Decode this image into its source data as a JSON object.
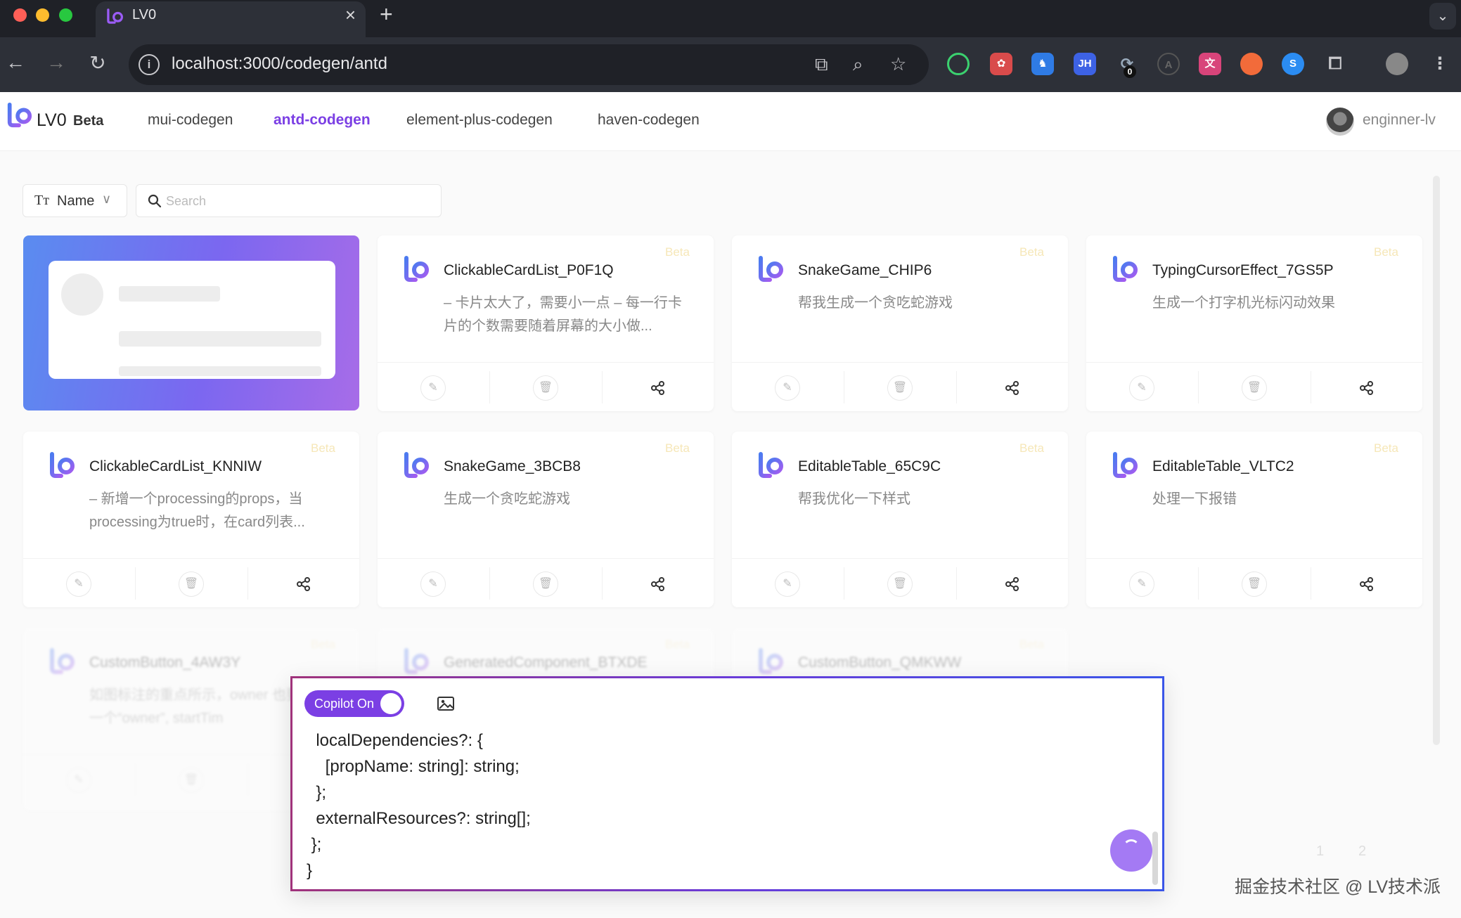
{
  "browser": {
    "tab_title": "LV0",
    "url": "localhost:3000/codegen/antd",
    "extension_badge": "0"
  },
  "header": {
    "brand": "LV0",
    "brand_badge": "Beta",
    "nav": [
      {
        "label": "mui-codegen",
        "active": false
      },
      {
        "label": "antd-codegen",
        "active": true
      },
      {
        "label": "element-plus-codegen",
        "active": false
      },
      {
        "label": "haven-codegen",
        "active": false
      }
    ],
    "user": "enginner-lv"
  },
  "filter": {
    "field_label": "Name",
    "search_placeholder": "Search"
  },
  "cards": [
    {
      "title": "ClickableCardList_P0F1Q",
      "badge": "Beta",
      "desc": "– 卡片太大了，需要小一点 – 每一行卡片的个数需要随着屏幕的大小做..."
    },
    {
      "title": "SnakeGame_CHIP6",
      "badge": "Beta",
      "desc": "帮我生成一个贪吃蛇游戏"
    },
    {
      "title": "TypingCursorEffect_7GS5P",
      "badge": "Beta",
      "desc": "生成一个打字机光标闪动效果"
    },
    {
      "title": "ClickableCardList_KNNIW",
      "badge": "Beta",
      "desc": "– 新增一个processing的props，当processing为true时，在card列表..."
    },
    {
      "title": "SnakeGame_3BCB8",
      "badge": "Beta",
      "desc": "生成一个贪吃蛇游戏"
    },
    {
      "title": "EditableTable_65C9C",
      "badge": "Beta",
      "desc": "帮我优化一下样式"
    },
    {
      "title": "EditableTable_VLTC2",
      "badge": "Beta",
      "desc": "处理一下报错"
    },
    {
      "title": "CustomButton_4AW3Y",
      "badge": "Beta",
      "desc": "如图标注的重点所示，owner 也要包含一个“owner”, startTim"
    },
    {
      "title": "GeneratedComponent_BTXDE",
      "badge": "Beta",
      "desc": ""
    },
    {
      "title": "CustomButton_QMKWW",
      "badge": "Beta",
      "desc": ""
    }
  ],
  "copilot": {
    "toggle_label": "Copilot On",
    "code": "  localDependencies?: {\n    [propName: string]: string;\n  };\n  externalResources?: string[];\n };\n}"
  },
  "pagination": {
    "pages": [
      "1",
      "2"
    ]
  },
  "watermark": "掘金技术社区 @ LV技术派",
  "colors": {
    "accent": "#7b3fe4",
    "badge": "#f6e7b8"
  }
}
